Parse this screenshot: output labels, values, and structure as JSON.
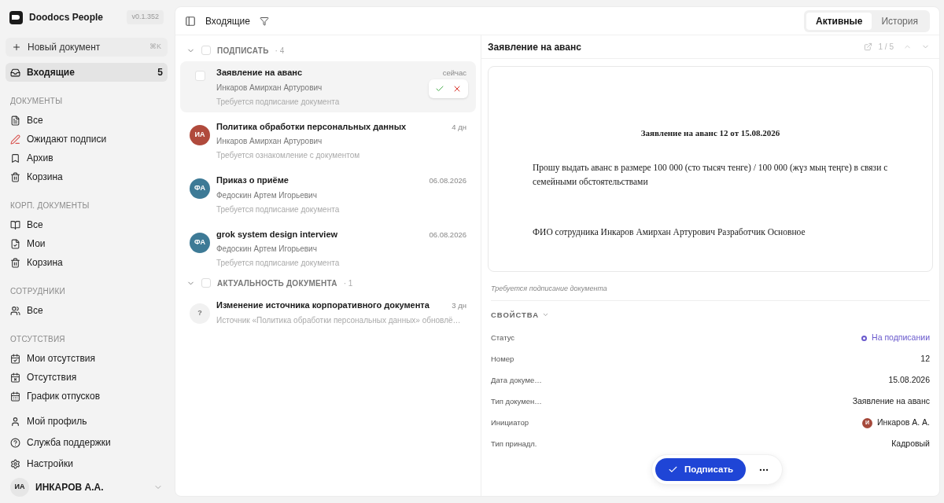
{
  "app": {
    "name": "Doodocs People",
    "version": "v0.1.352"
  },
  "new_document": {
    "label": "Новый документ",
    "shortcut": "⌘K"
  },
  "inbox": {
    "label": "Входящие",
    "count": "5",
    "selected": true
  },
  "sidebar_sections": [
    {
      "title": "ДОКУМЕНТЫ",
      "items": [
        {
          "label": "Все",
          "selected": false
        },
        {
          "label": "Ожидают подписи",
          "selected": false
        },
        {
          "label": "Архив",
          "selected": false
        },
        {
          "label": "Корзина",
          "selected": false
        }
      ]
    },
    {
      "title": "КОРП. ДОКУМЕНТЫ",
      "items": [
        {
          "label": "Все",
          "selected": false
        },
        {
          "label": "Мои",
          "selected": false
        },
        {
          "label": "Корзина",
          "selected": false
        }
      ]
    },
    {
      "title": "СОТРУДНИКИ",
      "items": [
        {
          "label": "Все",
          "selected": false
        }
      ]
    },
    {
      "title": "ОТСУТСТВИЯ",
      "items": [
        {
          "label": "Мои отсутствия",
          "selected": false
        },
        {
          "label": "Отсутствия",
          "selected": false
        },
        {
          "label": "График отпусков",
          "selected": false
        }
      ]
    }
  ],
  "sidebar_footer": [
    {
      "label": "Мой профиль"
    },
    {
      "label": "Служба поддержки"
    },
    {
      "label": "Настройки"
    }
  ],
  "user": {
    "initials": "ИА",
    "name": "ИНКАРОВ А.А."
  },
  "toolbar": {
    "title": "Входящие"
  },
  "tabs": [
    {
      "label": "Активные",
      "selected": true
    },
    {
      "label": "История",
      "selected": false
    }
  ],
  "groups": [
    {
      "title": "ПОДПИСАТЬ",
      "count": "· 4",
      "expanded": true,
      "checked": false,
      "items": [
        {
          "title": "Заявление на аванс",
          "author": "Инкаров Амирхан Артурович",
          "note": "Требуется подписание документа",
          "time": "сейчас",
          "selected": true,
          "checked": false
        },
        {
          "title": "Политика обработки персональных данных",
          "author": "Инкаров Амирхан Артурович",
          "note": "Требуется ознакомление с документом",
          "time": "4 дн",
          "avatar": "ИА",
          "color": "#b04a3c",
          "selected": false
        },
        {
          "title": "Приказ о приёме",
          "author": "Федоскин Артем Игорьевич",
          "note": "Требуется подписание документа",
          "time": "06.08.2026",
          "avatar": "ФА",
          "color": "#3d7a96",
          "selected": false
        },
        {
          "title": "grok system design interview",
          "author": "Федоскин Артем Игорьевич",
          "note": "Требуется подписание документа",
          "time": "06.08.2026",
          "avatar": "ФА",
          "color": "#3d7a96",
          "selected": false
        }
      ]
    },
    {
      "title": "АКТУАЛЬНОСТЬ ДОКУМЕНТА",
      "count": "· 1",
      "expanded": true,
      "checked": false,
      "items": [
        {
          "title": "Изменение источника корпоративного документа",
          "note": "Источник «Политика обработки персональных данных» обновлё…",
          "time": "3 дн",
          "avatar": "?",
          "color": "#f1f1f1",
          "selected": false
        }
      ]
    }
  ],
  "detail": {
    "title": "Заявление на аванс",
    "pager": "1 / 5",
    "document": {
      "heading": "Заявление на аванс 12 от 15.08.2026",
      "body": "Прошу выдать аванс в размере 100 000 (сто тысяч тенге) / 100 000 (жүз мың теңге) в связи с семейными обстоятельствами",
      "signature": "ФИО сотрудника Инкаров Амирхан Артурович Разработчик Основное"
    },
    "caption": "Требуется подписание документа",
    "properties_title": "СВОЙСТВА",
    "properties": [
      {
        "label": "Статус",
        "value": "На подписании",
        "kind": "status",
        "color": "#6a5acd"
      },
      {
        "label": "Номер",
        "value": "12",
        "kind": "text"
      },
      {
        "label": "Дата докуме…",
        "value": "15.08.2026",
        "kind": "text"
      },
      {
        "label": "Тип докумен…",
        "value": "Заявление на аванс",
        "kind": "text"
      },
      {
        "label": "Инициатор",
        "value": "Инкаров А. А.",
        "kind": "person",
        "avatar": "И",
        "color": "#a5493b"
      },
      {
        "label": "Тип принадл.",
        "value": "Кадровый",
        "kind": "text"
      }
    ],
    "sign_button": "Подписать"
  }
}
